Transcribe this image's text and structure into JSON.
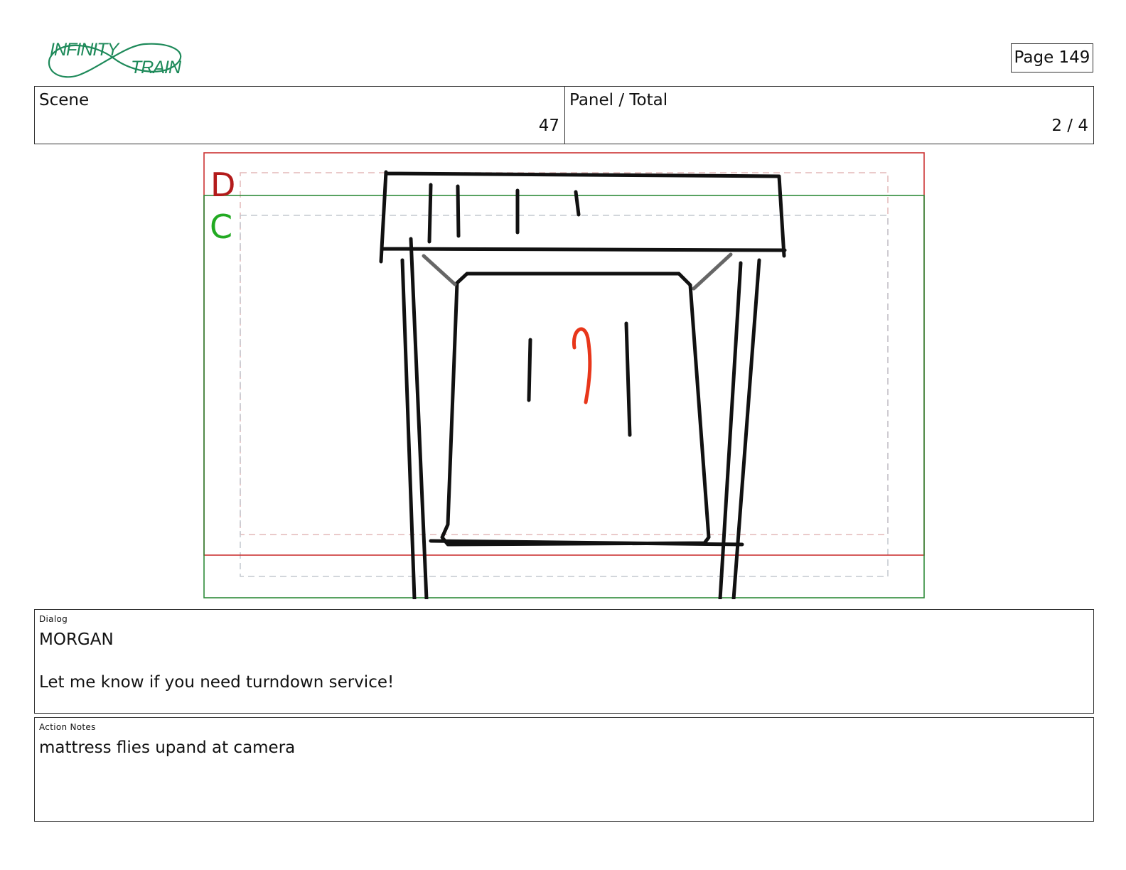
{
  "header": {
    "logo": {
      "line1": "INFINITY",
      "line2": "TRAIN",
      "color": "#1e8a5a"
    },
    "page_label": "Page 149",
    "scene_label": "Scene",
    "scene_value": "47",
    "panel_label": "Panel / Total",
    "panel_value": "2 / 4"
  },
  "panel": {
    "guide_labels": {
      "d": "D",
      "c": "C"
    },
    "colors": {
      "frame_red": "#cc3333",
      "guide_green": "#2e8b3a",
      "label_d": "#b31b1b",
      "label_c": "#22aa22",
      "ink": "#111111",
      "accent_red": "#e8361a",
      "grey": "#666666"
    }
  },
  "dialog": {
    "label": "Dialog",
    "character": "MORGAN",
    "line": "Let me know if you need turndown service!"
  },
  "action_notes": {
    "label": "Action Notes",
    "text": "mattress flies upand at camera"
  }
}
